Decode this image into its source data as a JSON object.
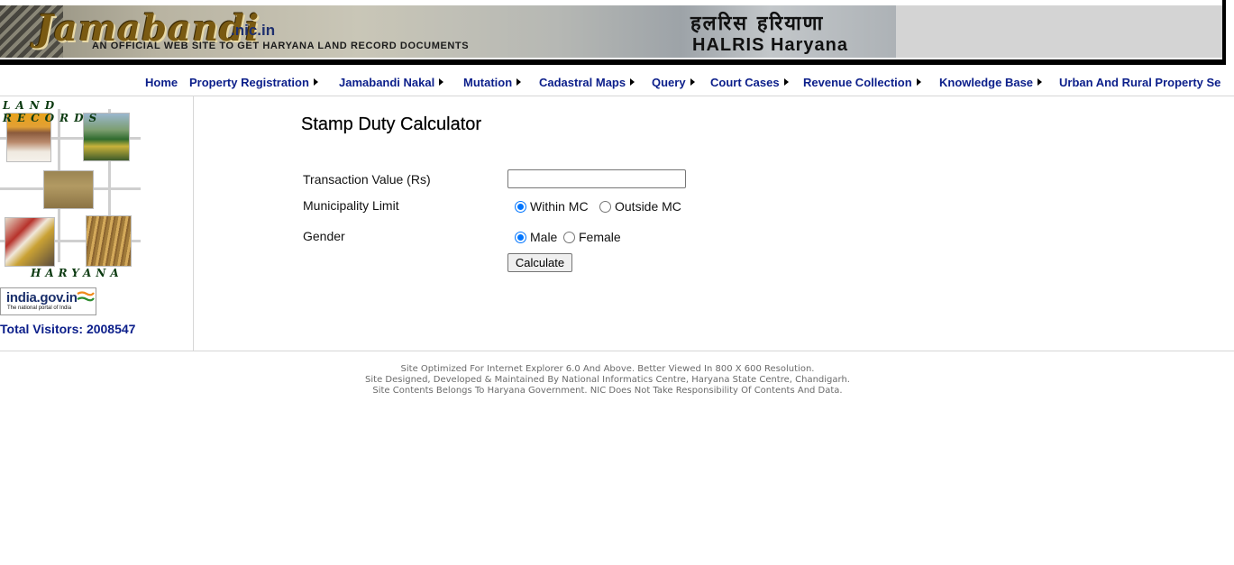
{
  "header": {
    "logo_text": "Jamabandi",
    "domain": ".nic.in",
    "tagline": "AN OFFICIAL WEB SITE TO GET HARYANA LAND RECORD DOCUMENTS",
    "hindi_title": "हलरिस हरियाणा",
    "halris_title": "HALRIS Haryana"
  },
  "nav": {
    "items": [
      {
        "label": "Home",
        "has_arrow": false
      },
      {
        "label": "Property Registration",
        "has_arrow": true
      },
      {
        "label": "Jamabandi Nakal",
        "has_arrow": true
      },
      {
        "label": "Mutation",
        "has_arrow": true
      },
      {
        "label": "Cadastral Maps",
        "has_arrow": true
      },
      {
        "label": "Query",
        "has_arrow": true
      },
      {
        "label": "Court Cases",
        "has_arrow": true
      },
      {
        "label": "Revenue Collection",
        "has_arrow": true
      },
      {
        "label": "Knowledge Base",
        "has_arrow": true
      },
      {
        "label": "Urban And Rural Property Se",
        "has_arrow": false
      }
    ]
  },
  "sidebar": {
    "collage_title": "LAND RECORDS",
    "collage_bottom": "HARYANA",
    "india_portal": {
      "title": "india.gov.in",
      "subtitle": "The national portal of India"
    },
    "visitors": "Total Visitors: 2008547"
  },
  "form": {
    "title": "Stamp Duty Calculator",
    "transaction_label": "Transaction Value (Rs)",
    "transaction_value": "",
    "municipality_label": "Municipality Limit",
    "municipality_options": [
      {
        "label": "Within MC",
        "checked": true
      },
      {
        "label": "Outside MC",
        "checked": false
      }
    ],
    "gender_label": "Gender",
    "gender_options": [
      {
        "label": "Male",
        "checked": true
      },
      {
        "label": "Female",
        "checked": false
      }
    ],
    "calculate_label": "Calculate"
  },
  "footer": {
    "lines": [
      "Site Optimized For Internet Explorer 6.0 And Above. Better Viewed In 800 X 600 Resolution.",
      "Site Designed, Developed & Maintained By National Informatics Centre, Haryana State Centre, Chandigarh.",
      "Site Contents Belongs To Haryana Government. NIC Does Not Take Responsibility Of Contents And Data."
    ]
  },
  "colors": {
    "nav_link": "#0b1e8a",
    "radio_checked": "#0075ff",
    "footer_text": "#6b6b6b"
  }
}
